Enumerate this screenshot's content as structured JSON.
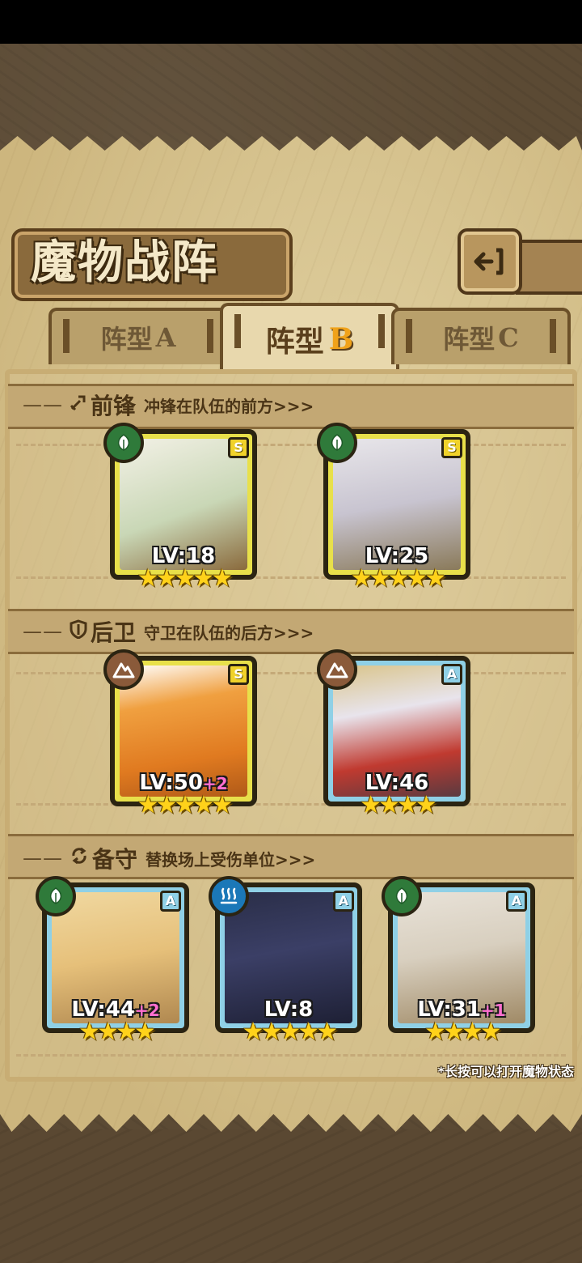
{
  "header": {
    "title": "魔物战阵"
  },
  "tabs": [
    {
      "label": "阵型",
      "letter": "A",
      "active": false
    },
    {
      "label": "阵型",
      "letter": "B",
      "active": true
    },
    {
      "label": "阵型",
      "letter": "C",
      "active": false
    }
  ],
  "sections": {
    "front": {
      "title": "前锋",
      "desc": "冲锋在队伍的前方>>>",
      "dash": "——",
      "icon": "sword-icon"
    },
    "back": {
      "title": "后卫",
      "desc": "守卫在队伍的后方>>>",
      "dash": "——",
      "icon": "shield-icon"
    },
    "reserve": {
      "title": "备守",
      "desc": "替换场上受伤单位>>>",
      "dash": "——",
      "icon": "swap-icon"
    }
  },
  "monsters": {
    "front_1": {
      "rank": "S",
      "element": "leaf",
      "level": "LV:18",
      "plus": "",
      "stars": "★★★★★",
      "star_count": 5
    },
    "front_2": {
      "rank": "S",
      "element": "leaf",
      "level": "LV:25",
      "plus": "",
      "stars": "★★★★★",
      "star_count": 5
    },
    "back_1": {
      "rank": "S",
      "element": "earth",
      "level": "LV:50",
      "plus": "+2",
      "stars": "★★★★★",
      "star_count": 5
    },
    "back_2": {
      "rank": "A",
      "element": "earth",
      "level": "LV:46",
      "plus": "",
      "stars": "★★★★",
      "star_count": 4
    },
    "reserve_1": {
      "rank": "A",
      "element": "leaf",
      "level": "LV:44",
      "plus": "+2",
      "stars": "★★★★",
      "star_count": 4
    },
    "reserve_2": {
      "rank": "A",
      "element": "water",
      "level": "LV:8",
      "plus": "",
      "stars": "★★★★★",
      "star_count": 5
    },
    "reserve_3": {
      "rank": "A",
      "element": "leaf",
      "level": "LV:31",
      "plus": "+1",
      "stars": "★★★★",
      "star_count": 4
    }
  },
  "footer": {
    "hint": "*长按可以打开魔物状态"
  },
  "colors": {
    "rank_s": "#e8e04a",
    "rank_a": "#8fd0e6",
    "star": "#ffd21a",
    "plus": "#ff6fd0"
  }
}
